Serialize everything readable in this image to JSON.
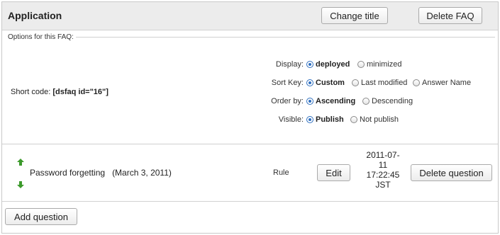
{
  "header": {
    "title": "Application",
    "change_title_label": "Change title",
    "delete_faq_label": "Delete FAQ"
  },
  "options": {
    "legend": "Options for this FAQ:",
    "short_code_label": "Short code:",
    "short_code_value": "[dsfaq id=\"16\"]",
    "display": {
      "label": "Display:",
      "choices": [
        {
          "label": "deployed",
          "checked": true
        },
        {
          "label": "minimized",
          "checked": false
        }
      ]
    },
    "sort_key": {
      "label": "Sort Key:",
      "choices": [
        {
          "label": "Custom",
          "checked": true
        },
        {
          "label": "Last modified",
          "checked": false
        },
        {
          "label": "Answer Name",
          "checked": false
        }
      ]
    },
    "order_by": {
      "label": "Order by:",
      "choices": [
        {
          "label": "Ascending",
          "checked": true
        },
        {
          "label": "Descending",
          "checked": false
        }
      ]
    },
    "visible": {
      "label": "Visible:",
      "choices": [
        {
          "label": "Publish",
          "checked": true
        },
        {
          "label": "Not publish",
          "checked": false
        }
      ]
    }
  },
  "question": {
    "title": "Password forgetting",
    "date": "(March 3, 2011)",
    "rule_label": "Rule",
    "edit_label": "Edit",
    "timestamp_lines": [
      "2011-07-",
      "11",
      "17:22:45",
      "JST"
    ],
    "delete_label": "Delete question",
    "move_up_color": "#3c9a2c",
    "move_down_color": "#3c9a2c"
  },
  "footer": {
    "add_question_label": "Add question"
  }
}
